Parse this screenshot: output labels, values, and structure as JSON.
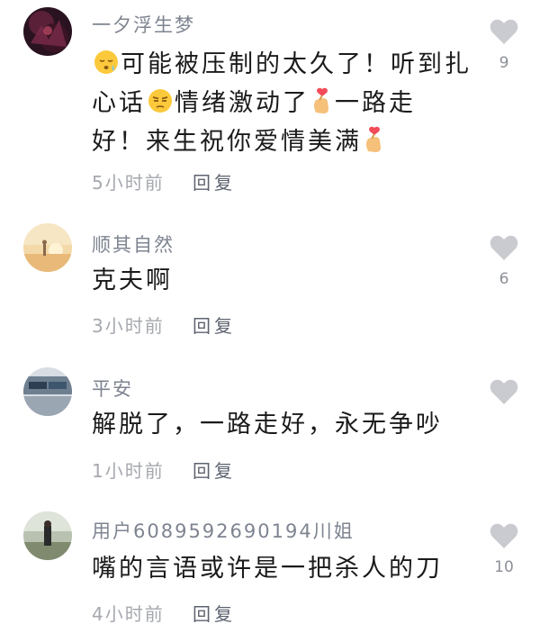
{
  "comments": [
    {
      "username": "一夕浮生梦",
      "lines": [
        [
          "",
          "可能被压制的太久了！听到扎"
        ],
        [
          "心话",
          "情绪激动了",
          "一路走"
        ],
        [
          "好！来生祝你爱情美满",
          ""
        ]
      ],
      "time": "5小时前",
      "reply": "回复",
      "likes": "9",
      "emojis": [
        "sleepy-face",
        "unamused-face",
        "finger-heart",
        "finger-heart"
      ]
    },
    {
      "username": "顺其自然",
      "lines": [
        [
          "克夫啊"
        ]
      ],
      "time": "3小时前",
      "reply": "回复",
      "likes": "6"
    },
    {
      "username": "平安",
      "lines": [
        [
          "解脱了，一路走好，永无争吵"
        ]
      ],
      "time": "1小时前",
      "reply": "回复",
      "likes": ""
    },
    {
      "username": "用户6089592690194川姐",
      "lines": [
        [
          "嘴的言语或许是一把杀人的刀"
        ]
      ],
      "time": "4小时前",
      "reply": "回复",
      "likes": "10"
    }
  ],
  "colors": {
    "username": "#7e8490",
    "body": "#1b1b1b",
    "meta": "#a5a8ae",
    "heart": "#c9cbd0"
  }
}
